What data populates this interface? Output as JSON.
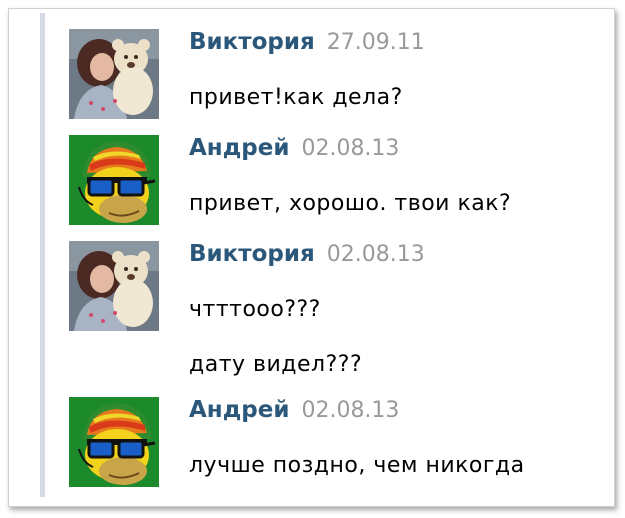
{
  "messages": [
    {
      "author": "Виктория",
      "date": "27.09.11",
      "avatar_icon": "girl-with-teddy-bear-photo",
      "lines": [
        "привет!как дела?"
      ]
    },
    {
      "author": "Андрей",
      "date": "02.08.13",
      "avatar_icon": "homer-with-sunglasses-icon",
      "lines": [
        "привет, хорошо. твои как?"
      ]
    },
    {
      "author": "Виктория",
      "date": "02.08.13",
      "avatar_icon": "girl-with-teddy-bear-photo",
      "lines": [
        "чтттooo???",
        "дату видел???"
      ]
    },
    {
      "author": "Андрей",
      "date": "02.08.13",
      "avatar_icon": "homer-with-sunglasses-icon",
      "lines": [
        "лучше поздно, чем никогда"
      ]
    }
  ],
  "colors": {
    "author_name": "#2b587a",
    "date": "#999999",
    "thread_bar": "#d4dbe6"
  }
}
